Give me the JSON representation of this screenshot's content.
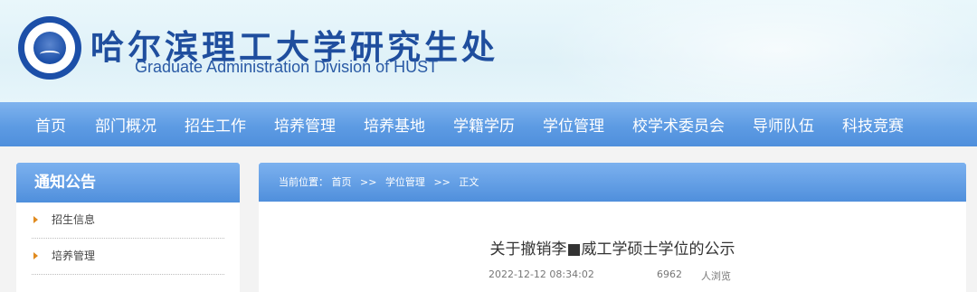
{
  "header": {
    "title_cn": "哈尔滨理工大学研究生处",
    "title_en": "Graduate Administration Division of HUST"
  },
  "nav": {
    "items": [
      "首页",
      "部门概况",
      "招生工作",
      "培养管理",
      "培养基地",
      "学籍学历",
      "学位管理",
      "校学术委员会",
      "导师队伍",
      "科技竞赛"
    ]
  },
  "sidebar": {
    "heading": "通知公告",
    "items": [
      "招生信息",
      "培养管理"
    ]
  },
  "breadcrumb": {
    "prefix": "当前位置：",
    "home": "首页",
    "sep": ">>",
    "section": "学位管理",
    "current": "正文"
  },
  "article": {
    "title": "关于撤销李■威工学硕士学位的公示",
    "date": "2022-12-12 08:34:02",
    "views": "6962",
    "views_suffix": "人浏览"
  },
  "colors": {
    "nav_blue": "#5d9be3",
    "title_blue": "#1f4e9e",
    "bullet_orange": "#e08a1e"
  }
}
